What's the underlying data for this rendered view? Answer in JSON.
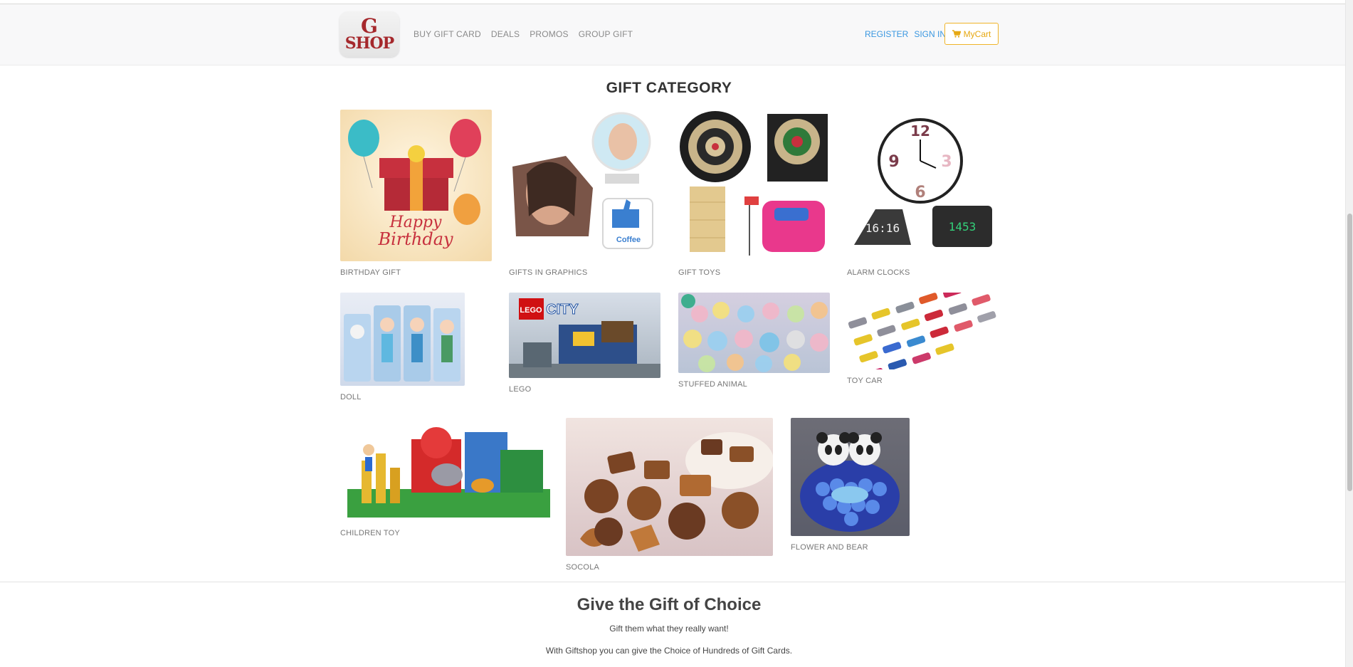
{
  "logo": {
    "line1": "G",
    "line2": "SHOP"
  },
  "nav": [
    "BUY GIFT CARD",
    "DEALS",
    "PROMOS",
    "GROUP GIFT"
  ],
  "auth": {
    "register": "REGISTER",
    "signin": "SIGN IN"
  },
  "cart": {
    "label": "MyCart",
    "icon": "cart-icon"
  },
  "section_title": "GIFT CATEGORY",
  "categories": [
    {
      "label": "BIRTHDAY GIFT",
      "image_text_1": "Happy",
      "image_text_2": "Birthday"
    },
    {
      "label": "GIFTS IN GRAPHICS",
      "image_text_1": "Coffee"
    },
    {
      "label": "GIFT TOYS"
    },
    {
      "label": "ALARM CLOCKS",
      "image_text_1": "16:16",
      "image_text_2": "1453"
    },
    {
      "label": "DOLL"
    },
    {
      "label": "LEGO",
      "image_text_1": "LEGO",
      "image_text_2": "CITY"
    },
    {
      "label": "STUFFED ANIMAL"
    },
    {
      "label": "TOY CAR"
    },
    {
      "label": "CHILDREN TOY"
    },
    {
      "label": "SOCOLA"
    },
    {
      "label": "FLOWER AND BEAR"
    }
  ],
  "footer": {
    "title": "Give the Gift of Choice",
    "subtitle": "Gift them what they really want!",
    "text": "With Giftshop you can give the Choice of Hundreds of Gift Cards."
  },
  "colors": {
    "brand": "#a5282c",
    "link": "#3a97e0",
    "cart": "#e6a812"
  }
}
